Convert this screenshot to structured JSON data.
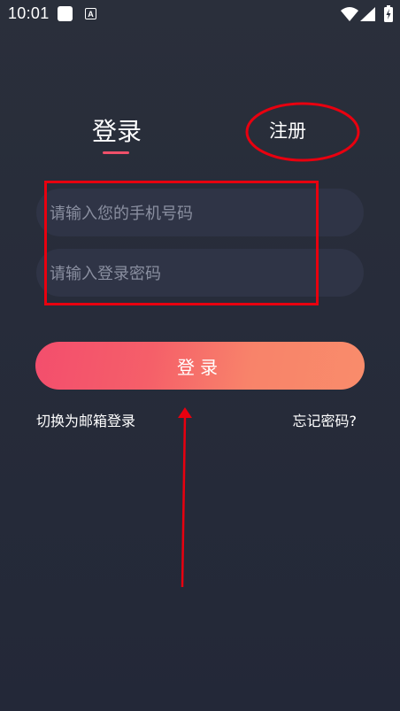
{
  "status_bar": {
    "time": "10:01",
    "notification_icon_letter": "A",
    "icons": [
      "app-square-icon",
      "text-a-icon",
      "wifi-icon",
      "signal-icon",
      "battery-charging-icon"
    ]
  },
  "tabs": {
    "login_label": "登录",
    "register_label": "注册"
  },
  "form": {
    "phone_placeholder": "请输入您的手机号码",
    "password_placeholder": "请输入登录密码"
  },
  "actions": {
    "login_button": "登录",
    "switch_email_login": "切换为邮箱登录",
    "forgot_password": "忘记密码?"
  },
  "colors": {
    "background": "#262b38",
    "input_background": "#2f3446",
    "accent_underline": "#f0506a",
    "button_gradient_start": "#f34e6d",
    "button_gradient_end": "#f98c6b",
    "annotation_red": "#e8000f"
  }
}
